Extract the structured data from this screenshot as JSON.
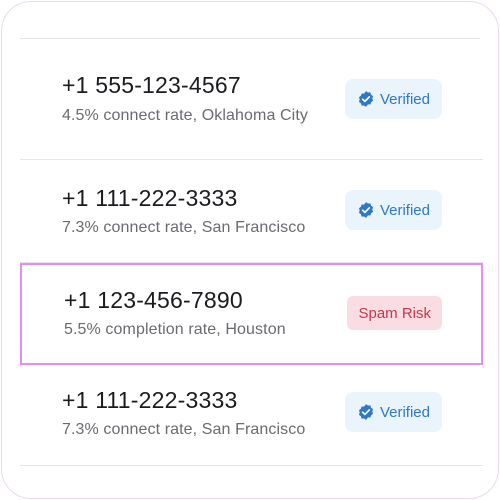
{
  "numbers": [
    {
      "phone": "+1 555-123-4567",
      "detail": "4.5% connect rate, Oklahoma City",
      "badge": "Verified",
      "status": "verified"
    },
    {
      "phone": "+1 111-222-3333",
      "detail": "7.3% connect rate, San Francisco",
      "badge": "Verified",
      "status": "verified"
    },
    {
      "phone": "+1 123-456-7890",
      "detail": "5.5% completion rate, Houston",
      "badge": "Spam Risk",
      "status": "spam"
    },
    {
      "phone": "+1 111-222-3333",
      "detail": "7.3% connect rate, San Francisco",
      "badge": "Verified",
      "status": "verified"
    }
  ],
  "colors": {
    "verified_bg": "#e9f4fd",
    "verified_text": "#2f78c4",
    "spam_bg": "#f9dde2",
    "spam_text": "#c7374c",
    "selection_border": "#e58df0"
  },
  "icons": {
    "verified": "verified-check-badge-icon"
  }
}
